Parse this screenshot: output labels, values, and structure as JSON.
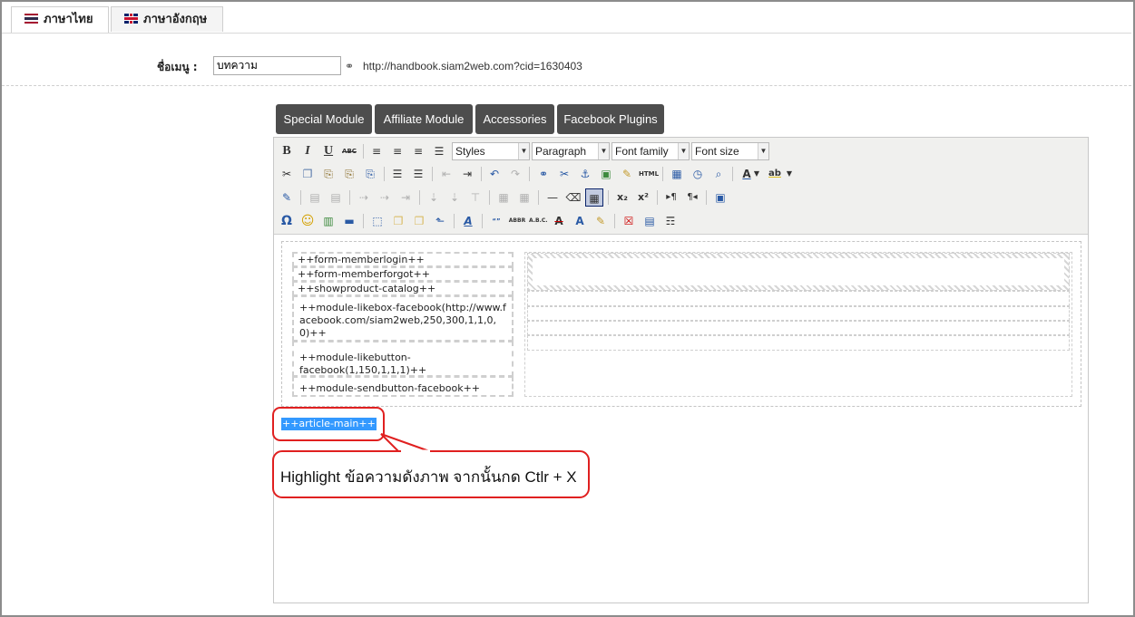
{
  "tabs": [
    {
      "label": "ภาษาไทย",
      "flag": "thai-flag-icon",
      "active": true
    },
    {
      "label": "ภาษาอังกฤษ",
      "flag": "uk-flag-icon",
      "active": false
    }
  ],
  "menu_name": {
    "label": "ชื่อเมนู :",
    "value": "บทความ",
    "url": "http://handbook.siam2web.com?cid=1630403"
  },
  "module_buttons": [
    "Special Module",
    "Affiliate Module",
    "Accessories",
    "Facebook Plugins"
  ],
  "toolbar": {
    "styles": "Styles",
    "format": "Paragraph",
    "font_family": "Font family",
    "font_size": "Font size",
    "html_label": "HTML"
  },
  "content": {
    "left_cells": [
      "++form-memberlogin++",
      "++form-memberforgot++",
      "++showproduct-catalog++",
      "++module-likebox-facebook(http://www.facebook.com/siam2web,250,300,1,1,0,0)++",
      "++module-likebutton-facebook(1,150,1,1,1)++",
      "++module-sendbutton-facebook++"
    ],
    "selected_text": "++article-main++"
  },
  "callout": {
    "text": "Highlight ข้อความดังภาพ จากนั้นกด Ctlr + X",
    "border_color": "#e02020"
  },
  "colors": {
    "module_button_bg": "#4d4d4d",
    "selection": "#3399ff",
    "toolbar_bg": "#f0f0ee"
  }
}
